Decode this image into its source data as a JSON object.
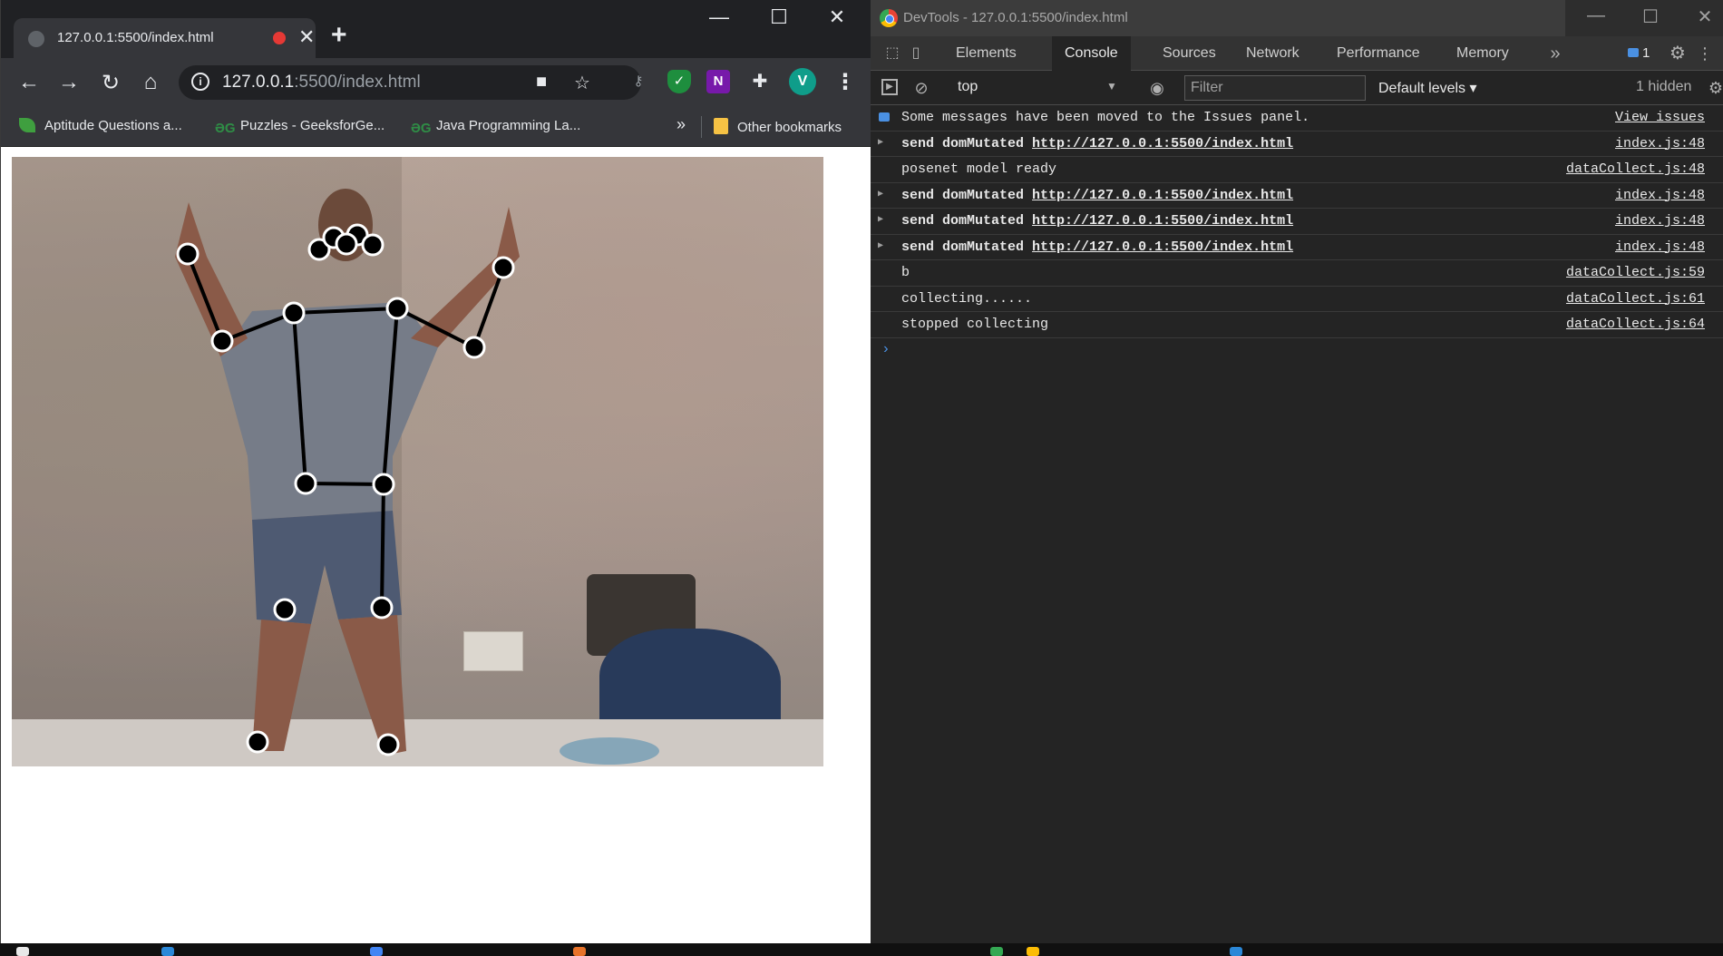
{
  "browser": {
    "tab": {
      "title": "127.0.0.1:5500/index.html",
      "close": "✕"
    },
    "new_tab": "+",
    "window_controls": {
      "minimize": "—",
      "maximize": "☐",
      "close": "✕"
    },
    "nav": {
      "back": "←",
      "forward": "→",
      "reload": "↻",
      "home": "⌂"
    },
    "omnibox": {
      "host": "127.0.0.1",
      "rest": ":5500/index.html"
    },
    "extensions": {
      "onenote_label": "N",
      "avatar_letter": "V"
    },
    "bookmarks": [
      {
        "label": "Aptitude Questions a...",
        "icon": "leaf-icon"
      },
      {
        "label": "Puzzles - GeeksforGe...",
        "icon": "geeksforgeeks-icon"
      },
      {
        "label": "Java Programming La...",
        "icon": "geeksforgeeks-icon"
      }
    ],
    "bookmarks_overflow": "»",
    "other_bookmarks": "Other bookmarks"
  },
  "devtools": {
    "window_title": "DevTools - 127.0.0.1:5500/index.html",
    "window_controls": {
      "minimize": "—",
      "maximize": "☐",
      "close": "✕"
    },
    "tabs": [
      "Elements",
      "Console",
      "Sources",
      "Network",
      "Performance",
      "Memory"
    ],
    "active_tab": "Console",
    "overflow": "»",
    "issues_badge": "1",
    "context": "top",
    "filter_placeholder": "Filter",
    "levels": "Default levels ▾",
    "hidden": "1 hidden",
    "messages": [
      {
        "type": "info",
        "text": "Some messages have been moved to the Issues panel.",
        "src": "View issues"
      },
      {
        "type": "expand",
        "prefix": "send domMutated",
        "link": "http://127.0.0.1:5500/index.html",
        "src": "index.js:48"
      },
      {
        "type": "plain",
        "text": "posenet model ready",
        "src": "dataCollect.js:48"
      },
      {
        "type": "expand",
        "prefix": "send domMutated",
        "link": "http://127.0.0.1:5500/index.html",
        "src": "index.js:48"
      },
      {
        "type": "expand",
        "prefix": "send domMutated",
        "link": "http://127.0.0.1:5500/index.html",
        "src": "index.js:48"
      },
      {
        "type": "expand",
        "prefix": "send domMutated",
        "link": "http://127.0.0.1:5500/index.html",
        "src": "index.js:48"
      },
      {
        "type": "plain",
        "text": "b",
        "src": "dataCollect.js:59"
      },
      {
        "type": "plain",
        "text": "collecting......",
        "src": "dataCollect.js:61"
      },
      {
        "type": "plain",
        "text": "stopped collecting",
        "src": "dataCollect.js:64"
      }
    ],
    "prompt": "›"
  },
  "colors": {
    "browser_frame": "#202124",
    "toolbar": "#35363a",
    "devtools_bg": "#242424",
    "link_blue": "#4a90e2",
    "record_red": "#e53935"
  }
}
